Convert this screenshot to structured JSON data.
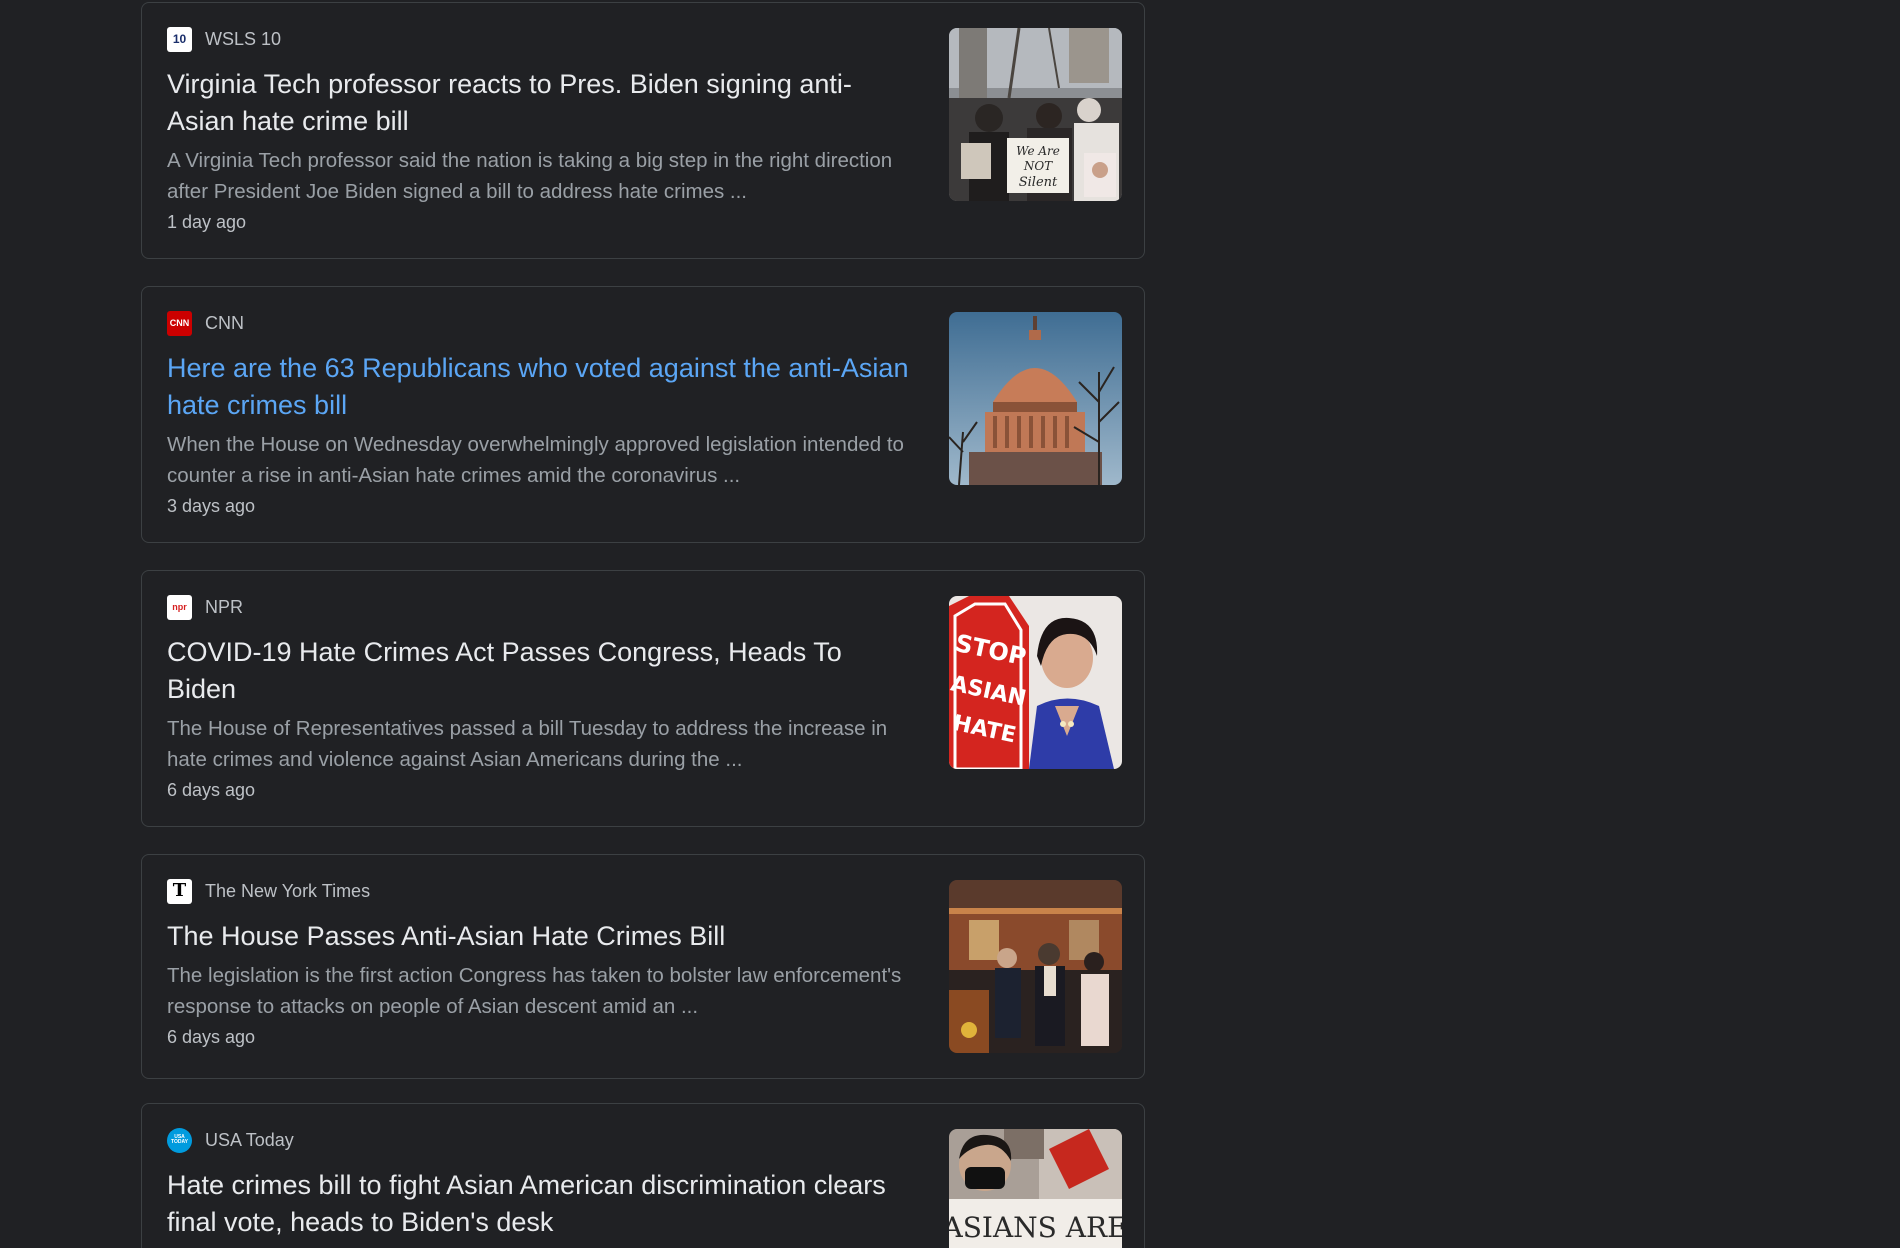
{
  "articles": [
    {
      "source": "WSLS 10",
      "favicon_text": "10",
      "favicon_bg": "#ffffff",
      "favicon_fg": "#1a2e6b",
      "headline": "Virginia Tech professor reacts to Pres. Biden signing anti-Asian hate crime bill",
      "snippet": "A Virginia Tech professor said the nation is taking a big step in the right direction after President Joe Biden signed a bill to address hate crimes ...",
      "time": "1 day ago",
      "thumbnail_sign_text": "We Are NOT Silent",
      "visited": false
    },
    {
      "source": "CNN",
      "favicon_text": "CNN",
      "favicon_bg": "#cc0000",
      "favicon_fg": "#ffffff",
      "headline": "Here are the 63 Republicans who voted against the anti-Asian hate crimes bill",
      "snippet": "When the House on Wednesday overwhelmingly approved legislation intended to counter a rise in anti-Asian hate crimes amid the coronavirus ...",
      "time": "3 days ago",
      "visited": true
    },
    {
      "source": "NPR",
      "favicon_text": "npr",
      "favicon_bg": "#ffffff",
      "favicon_fg": "#d62021",
      "headline": "COVID-19 Hate Crimes Act Passes Congress, Heads To Biden",
      "snippet": "The House of Representatives passed a bill Tuesday to address the increase in hate crimes and violence against Asian Americans during the ...",
      "time": "6 days ago",
      "thumbnail_sign_text": "STOP ASIAN HATE",
      "visited": false
    },
    {
      "source": "The New York Times",
      "favicon_text": "T",
      "favicon_bg": "#ffffff",
      "favicon_fg": "#000000",
      "headline": "The House Passes Anti-Asian Hate Crimes Bill",
      "snippet": "The legislation is the first action Congress has taken to bolster law enforcement's response to attacks on people of Asian descent amid an ...",
      "time": "6 days ago",
      "visited": false
    },
    {
      "source": "USA Today",
      "favicon_text": "USA TODAY",
      "favicon_bg": "#009bde",
      "favicon_fg": "#ffffff",
      "headline": "Hate crimes bill to fight Asian American discrimination clears final vote, heads to Biden's desk",
      "snippet": "",
      "time": "",
      "thumbnail_sign_text": "ASIANS ARE",
      "visited": false
    }
  ],
  "colors": {
    "background": "#202124",
    "card_border": "#3c4043",
    "headline": "#e8eaed",
    "visited_link": "#5ba6f5",
    "snippet": "#9aa0a6"
  }
}
